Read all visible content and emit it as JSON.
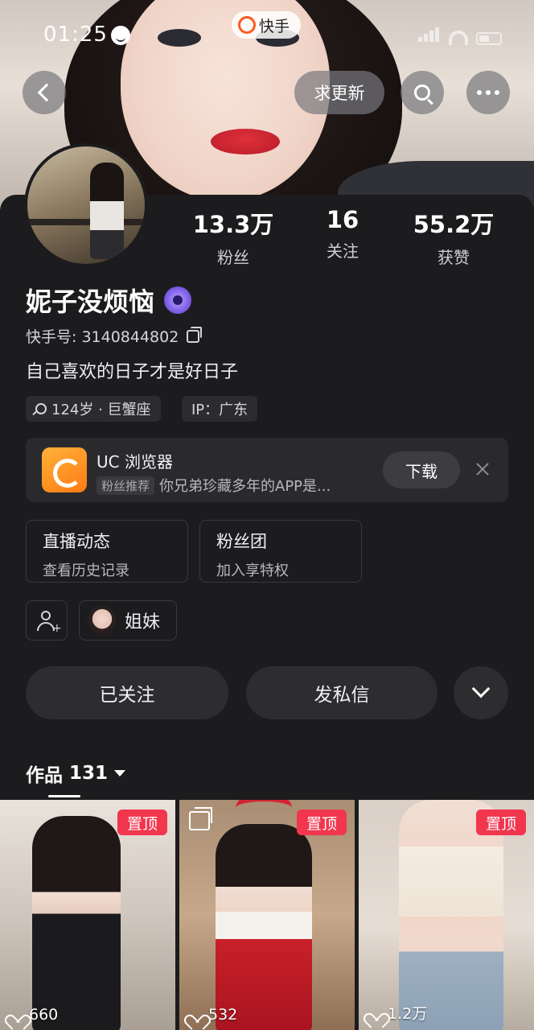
{
  "status_bar": {
    "time": "01:25"
  },
  "app": {
    "name": "快手"
  },
  "top_bar": {
    "request_update_label": "求更新"
  },
  "profile": {
    "name": "妮子没烦恼",
    "ks_id": "快手号: 3140844802",
    "bio": "自己喜欢的日子才是好日子",
    "tags": {
      "age": "124岁 · 巨蟹座",
      "ip": "IP：广东"
    },
    "stats": [
      {
        "value": "13.3万",
        "label": "粉丝"
      },
      {
        "value": "16",
        "label": "关注"
      },
      {
        "value": "55.2万",
        "label": "获赞"
      }
    ]
  },
  "ad": {
    "title": "UC 浏览器",
    "tag": "粉丝推荐",
    "subtitle": "你兄弟珍藏多年的APP是...",
    "download_label": "下载"
  },
  "features": [
    {
      "title": "直播动态",
      "subtitle": "查看历史记录"
    },
    {
      "title": "粉丝团",
      "subtitle": "加入享特权"
    }
  ],
  "relation": {
    "label": "姐妹"
  },
  "actions": {
    "followed_label": "已关注",
    "message_label": "发私信"
  },
  "works": {
    "tab_label": "作品",
    "count": "131",
    "items": [
      {
        "pinned": "置顶",
        "likes": "660"
      },
      {
        "pinned": "置顶",
        "likes": "532"
      },
      {
        "pinned": "置顶",
        "likes": "1.2万"
      }
    ]
  },
  "colors": {
    "background": "#1c1c1e",
    "pin_badge": "#f1364e",
    "card": "#2a2a2d"
  }
}
